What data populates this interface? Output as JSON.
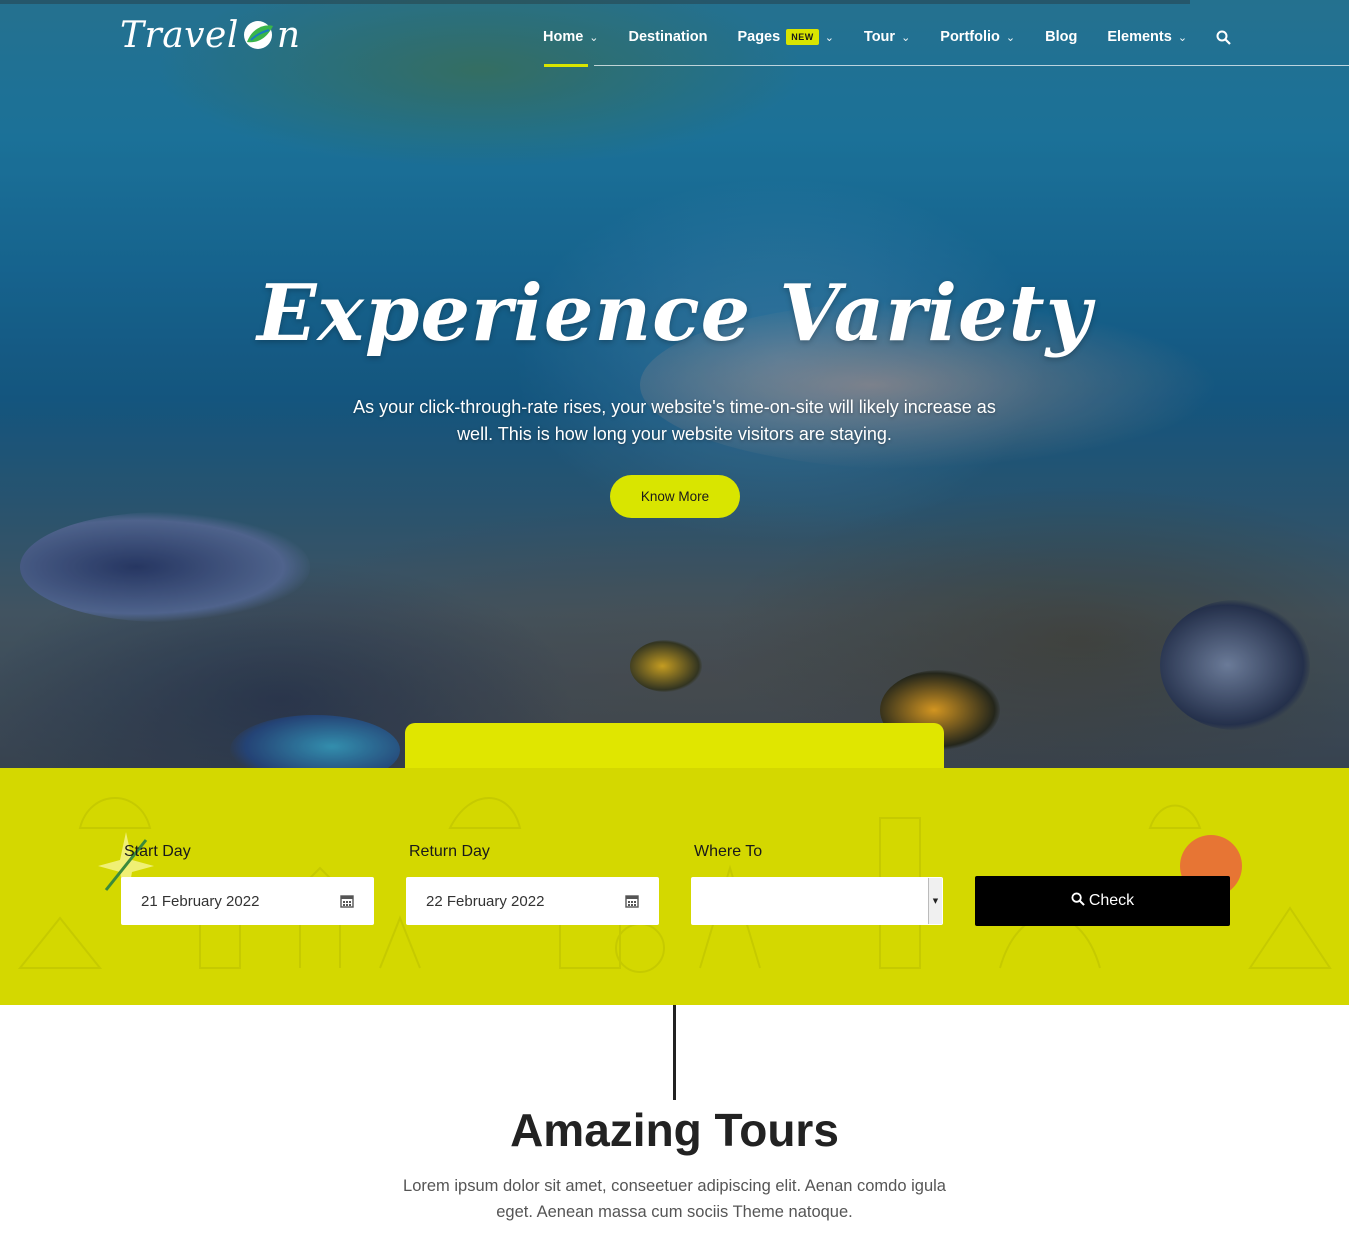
{
  "brand": {
    "logo_text_left": "Travel",
    "logo_text_right": "n"
  },
  "nav": {
    "items": [
      {
        "label": "Home",
        "has_dropdown": true,
        "active": true
      },
      {
        "label": "Destination",
        "has_dropdown": false
      },
      {
        "label": "Pages",
        "has_dropdown": true,
        "badge": "NEW"
      },
      {
        "label": "Tour",
        "has_dropdown": true
      },
      {
        "label": "Portfolio",
        "has_dropdown": true
      },
      {
        "label": "Blog",
        "has_dropdown": false
      },
      {
        "label": "Elements",
        "has_dropdown": true
      }
    ],
    "search_icon": "search-icon",
    "chevron_glyph": "⌄"
  },
  "hero": {
    "title": "Experience Variety",
    "subtitle": "As your click-through-rate rises, your website's time-on-site will likely increase as well. This is how long your website visitors are staying.",
    "cta_label": "Know More"
  },
  "booking": {
    "start_label": "Start Day",
    "start_value": "21 February 2022",
    "return_label": "Return Day",
    "return_value": "22 February 2022",
    "where_label": "Where To",
    "where_value": "",
    "check_label": "Check"
  },
  "tours": {
    "title": "Amazing Tours",
    "text": "Lorem ipsum dolor sit amet, conseetuer adipiscing elit. Aenan comdo igula eget. Aenean massa cum sociis Theme natoque."
  },
  "colors": {
    "accent": "#d9e500",
    "booking_bg": "#d4d800",
    "dark": "#000000"
  }
}
